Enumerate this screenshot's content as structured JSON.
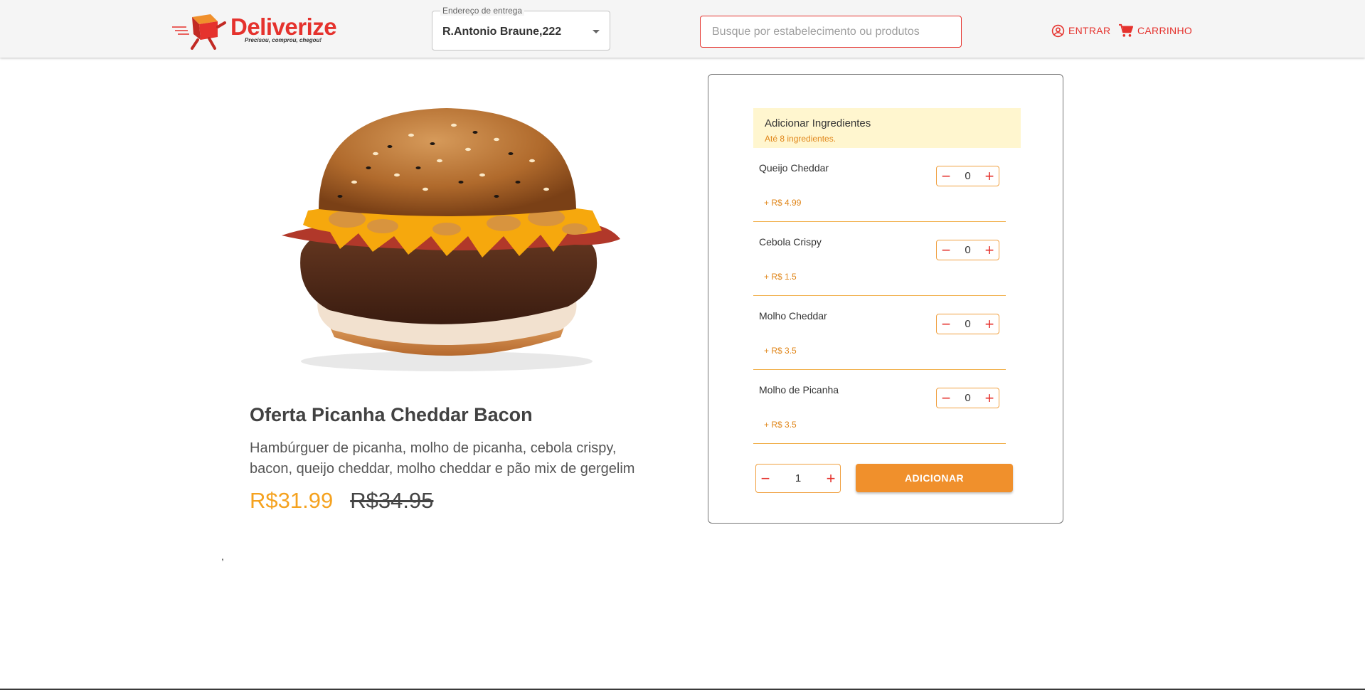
{
  "header": {
    "logo": {
      "brand": "Deliverize",
      "tagline": "Precisou, comprou, chegou!"
    },
    "address": {
      "label": "Endereço de entrega",
      "value": "R.Antonio Braune,222"
    },
    "search": {
      "placeholder": "Busque por estabelecimento ou produtos",
      "value": ""
    },
    "login_label": "ENTRAR",
    "cart_label": "CARRINHO"
  },
  "product": {
    "name": "Oferta Picanha Cheddar Bacon",
    "description": "Hambúrguer de picanha, molho de picanha, cebola crispy, bacon, queijo cheddar, molho cheddar e pão mix de gergelim",
    "price": "R$31.99",
    "old_price": "R$34.95",
    "stray_text": ","
  },
  "ingredients": {
    "title": "Adicionar Ingredientes",
    "subtitle": "Até 8 ingredientes.",
    "items": [
      {
        "name": "Queijo Cheddar",
        "price": "+ R$ 4.99",
        "qty": "0"
      },
      {
        "name": "Cebola Crispy",
        "price": "+ R$ 1.5",
        "qty": "0"
      },
      {
        "name": "Molho Cheddar",
        "price": "+ R$ 3.5",
        "qty": "0"
      },
      {
        "name": "Molho de Picanha",
        "price": "+ R$ 3.5",
        "qty": "0"
      }
    ]
  },
  "order": {
    "qty": "1",
    "add_label": "ADICIONAR"
  },
  "colors": {
    "brand_red": "#e5322d",
    "accent_orange": "#f0902c",
    "price_orange": "#f5a21f",
    "highlight_bg": "#fff6cf"
  },
  "icons": {
    "minus": "minus-icon",
    "plus": "plus-icon",
    "user": "user-circle-icon",
    "cart": "cart-icon"
  }
}
